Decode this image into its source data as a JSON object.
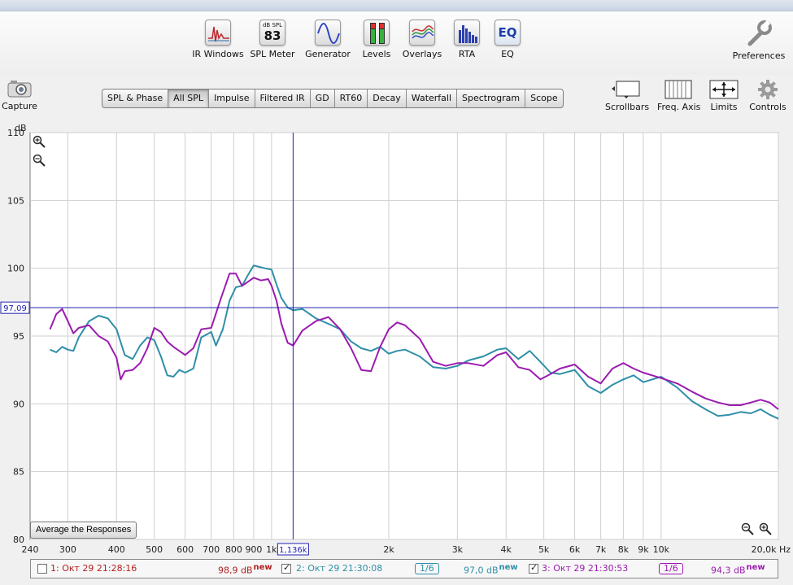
{
  "toolbar": {
    "items": [
      {
        "name": "ir-windows",
        "label": "IR Windows"
      },
      {
        "name": "spl-meter",
        "label": "SPL Meter",
        "icon_top": "dB SPL",
        "icon_value": "83"
      },
      {
        "name": "generator",
        "label": "Generator"
      },
      {
        "name": "levels",
        "label": "Levels"
      },
      {
        "name": "overlays",
        "label": "Overlays"
      },
      {
        "name": "rta",
        "label": "RTA"
      },
      {
        "name": "eq",
        "label": "EQ",
        "icon_text": "EQ"
      }
    ],
    "preferences_label": "Preferences",
    "capture_label": "Capture"
  },
  "tabs": [
    "SPL & Phase",
    "All SPL",
    "Impulse",
    "Filtered IR",
    "GD",
    "RT60",
    "Decay",
    "Waterfall",
    "Spectrogram",
    "Scope"
  ],
  "active_tab": "All SPL",
  "right_tools": {
    "scrollbars": "Scrollbars",
    "freq_axis": "Freq. Axis",
    "limits": "Limits",
    "controls": "Controls"
  },
  "avg_button_label": "Average the Responses",
  "chart_data": {
    "type": "line",
    "ylabel": "dB",
    "xunit": "Hz",
    "x_scale": "log",
    "xlim": [
      240,
      20000
    ],
    "ylim": [
      80,
      110
    ],
    "yticks": [
      80,
      85,
      90,
      95,
      100,
      105,
      110
    ],
    "xticks": [
      {
        "v": 240,
        "label": "240"
      },
      {
        "v": 300,
        "label": "300"
      },
      {
        "v": 400,
        "label": "400"
      },
      {
        "v": 500,
        "label": "500"
      },
      {
        "v": 600,
        "label": "600"
      },
      {
        "v": 700,
        "label": "700"
      },
      {
        "v": 800,
        "label": "800"
      },
      {
        "v": 900,
        "label": "900"
      },
      {
        "v": 1000,
        "label": "1k"
      },
      {
        "v": 2000,
        "label": "2k"
      },
      {
        "v": 3000,
        "label": "3k"
      },
      {
        "v": 4000,
        "label": "4k"
      },
      {
        "v": 5000,
        "label": "5k"
      },
      {
        "v": 6000,
        "label": "6k"
      },
      {
        "v": 7000,
        "label": "7k"
      },
      {
        "v": 8000,
        "label": "8k"
      },
      {
        "v": 9000,
        "label": "9k"
      },
      {
        "v": 10000,
        "label": "10k"
      },
      {
        "v": 20000,
        "label": "20,0k Hz"
      }
    ],
    "grid": true,
    "cursor": {
      "x": 1136,
      "y": 97.09,
      "x_label": "1,136k",
      "y_label": "97,09"
    },
    "series": [
      {
        "name": "2: Окт 29 21:30:08",
        "color": "#2f8fa8",
        "points": [
          [
            270,
            94.0
          ],
          [
            280,
            93.8
          ],
          [
            290,
            94.2
          ],
          [
            300,
            94.0
          ],
          [
            310,
            93.9
          ],
          [
            320,
            94.9
          ],
          [
            340,
            96.1
          ],
          [
            360,
            96.5
          ],
          [
            380,
            96.3
          ],
          [
            400,
            95.5
          ],
          [
            420,
            93.6
          ],
          [
            440,
            93.3
          ],
          [
            460,
            94.3
          ],
          [
            480,
            94.9
          ],
          [
            500,
            94.7
          ],
          [
            520,
            93.5
          ],
          [
            540,
            92.1
          ],
          [
            560,
            92.0
          ],
          [
            580,
            92.5
          ],
          [
            600,
            92.3
          ],
          [
            630,
            92.6
          ],
          [
            660,
            94.9
          ],
          [
            700,
            95.3
          ],
          [
            720,
            94.3
          ],
          [
            750,
            95.5
          ],
          [
            780,
            97.6
          ],
          [
            810,
            98.6
          ],
          [
            840,
            98.7
          ],
          [
            870,
            99.5
          ],
          [
            900,
            100.2
          ],
          [
            930,
            100.1
          ],
          [
            960,
            100.0
          ],
          [
            1000,
            99.9
          ],
          [
            1030,
            98.8
          ],
          [
            1060,
            97.8
          ],
          [
            1100,
            97.1
          ],
          [
            1136,
            96.9
          ],
          [
            1200,
            97.0
          ],
          [
            1300,
            96.3
          ],
          [
            1400,
            95.9
          ],
          [
            1500,
            95.5
          ],
          [
            1600,
            94.6
          ],
          [
            1700,
            94.1
          ],
          [
            1800,
            93.9
          ],
          [
            1900,
            94.2
          ],
          [
            2000,
            93.7
          ],
          [
            2100,
            93.9
          ],
          [
            2200,
            94.0
          ],
          [
            2400,
            93.5
          ],
          [
            2600,
            92.7
          ],
          [
            2800,
            92.6
          ],
          [
            3000,
            92.8
          ],
          [
            3200,
            93.2
          ],
          [
            3500,
            93.5
          ],
          [
            3800,
            94.0
          ],
          [
            4000,
            94.1
          ],
          [
            4300,
            93.3
          ],
          [
            4600,
            93.9
          ],
          [
            4900,
            93.1
          ],
          [
            5200,
            92.3
          ],
          [
            5500,
            92.2
          ],
          [
            6000,
            92.5
          ],
          [
            6500,
            91.3
          ],
          [
            7000,
            90.8
          ],
          [
            7500,
            91.4
          ],
          [
            8000,
            91.8
          ],
          [
            8500,
            92.1
          ],
          [
            9000,
            91.6
          ],
          [
            10000,
            92.0
          ],
          [
            11000,
            91.2
          ],
          [
            12000,
            90.2
          ],
          [
            13000,
            89.6
          ],
          [
            14000,
            89.1
          ],
          [
            15000,
            89.2
          ],
          [
            16000,
            89.4
          ],
          [
            17000,
            89.3
          ],
          [
            18000,
            89.6
          ],
          [
            19000,
            89.2
          ],
          [
            20000,
            88.9
          ]
        ]
      },
      {
        "name": "3: Окт 29 21:30:53",
        "color": "#9b1bb0",
        "points": [
          [
            270,
            95.5
          ],
          [
            280,
            96.6
          ],
          [
            290,
            97.0
          ],
          [
            300,
            96.1
          ],
          [
            310,
            95.2
          ],
          [
            320,
            95.6
          ],
          [
            340,
            95.8
          ],
          [
            360,
            95.0
          ],
          [
            380,
            94.6
          ],
          [
            400,
            93.4
          ],
          [
            410,
            91.8
          ],
          [
            420,
            92.4
          ],
          [
            440,
            92.5
          ],
          [
            460,
            93.0
          ],
          [
            480,
            94.1
          ],
          [
            500,
            95.6
          ],
          [
            520,
            95.3
          ],
          [
            540,
            94.6
          ],
          [
            560,
            94.2
          ],
          [
            580,
            93.9
          ],
          [
            600,
            93.6
          ],
          [
            630,
            94.1
          ],
          [
            660,
            95.5
          ],
          [
            700,
            95.6
          ],
          [
            740,
            97.7
          ],
          [
            780,
            99.6
          ],
          [
            810,
            99.6
          ],
          [
            840,
            98.7
          ],
          [
            870,
            99.0
          ],
          [
            900,
            99.3
          ],
          [
            940,
            99.1
          ],
          [
            980,
            99.2
          ],
          [
            1000,
            98.7
          ],
          [
            1030,
            97.6
          ],
          [
            1060,
            95.9
          ],
          [
            1100,
            94.5
          ],
          [
            1136,
            94.3
          ],
          [
            1200,
            95.4
          ],
          [
            1300,
            96.1
          ],
          [
            1400,
            96.4
          ],
          [
            1500,
            95.5
          ],
          [
            1600,
            94.1
          ],
          [
            1700,
            92.5
          ],
          [
            1800,
            92.4
          ],
          [
            1900,
            94.2
          ],
          [
            2000,
            95.5
          ],
          [
            2100,
            96.0
          ],
          [
            2200,
            95.8
          ],
          [
            2400,
            94.8
          ],
          [
            2600,
            93.1
          ],
          [
            2800,
            92.8
          ],
          [
            3000,
            93.0
          ],
          [
            3200,
            93.0
          ],
          [
            3500,
            92.8
          ],
          [
            3800,
            93.6
          ],
          [
            4000,
            93.8
          ],
          [
            4300,
            92.7
          ],
          [
            4600,
            92.5
          ],
          [
            4900,
            91.8
          ],
          [
            5200,
            92.2
          ],
          [
            5500,
            92.6
          ],
          [
            6000,
            92.9
          ],
          [
            6500,
            92.0
          ],
          [
            7000,
            91.5
          ],
          [
            7500,
            92.6
          ],
          [
            8000,
            93.0
          ],
          [
            8500,
            92.6
          ],
          [
            9000,
            92.3
          ],
          [
            10000,
            91.9
          ],
          [
            11000,
            91.5
          ],
          [
            12000,
            90.9
          ],
          [
            13000,
            90.4
          ],
          [
            14000,
            90.1
          ],
          [
            15000,
            89.9
          ],
          [
            16000,
            89.9
          ],
          [
            17000,
            90.1
          ],
          [
            18000,
            90.3
          ],
          [
            19000,
            90.1
          ],
          [
            20000,
            89.6
          ]
        ]
      }
    ]
  },
  "legend": [
    {
      "checked": false,
      "name": "1: Окт 29 21:28:16",
      "level": "98,9 dB",
      "tag": "new",
      "color": "#b02020",
      "smoothing": ""
    },
    {
      "checked": true,
      "name": "2: Окт 29 21:30:08",
      "level": "97,0 dB",
      "tag": "new",
      "color": "#2f8fa8",
      "smoothing": "1/6"
    },
    {
      "checked": true,
      "name": "3: Окт 29 21:30:53",
      "level": "94,3 dB",
      "tag": "new",
      "color": "#9b1bb0",
      "smoothing": "1/6"
    }
  ]
}
